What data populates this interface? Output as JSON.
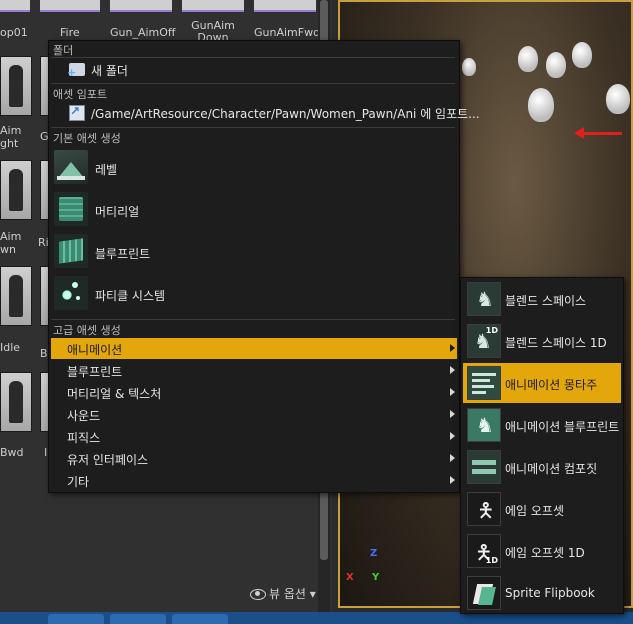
{
  "browser": {
    "top_labels": [
      "op01",
      "Fire",
      "Gun_AimOff",
      "GunAim Down",
      "GunAimFwd"
    ],
    "left_labels": [
      "Aim",
      "ght",
      "G",
      "Aim",
      "wn",
      "Ri",
      "Idle",
      "B",
      "Bwd",
      "I"
    ],
    "view_options": "뷰 옵션"
  },
  "menu": {
    "folder_header": "폴더",
    "new_folder": "새 폴더",
    "import_header": "애셋 임포트",
    "import_path": "/Game/ArtResource/Character/Pawn/Women_Pawn/Ani 에 임포트...",
    "basic_header": "기본 애셋 생성",
    "basic_items": [
      "레벨",
      "머티리얼",
      "블루프린트",
      "파티클 시스템"
    ],
    "advanced_header": "고급 애셋 생성",
    "advanced_items": [
      "애니메이션",
      "블루프린트",
      "머티리얼 & 텍스처",
      "사운드",
      "피직스",
      "유저 인터페이스",
      "기타"
    ]
  },
  "submenu": {
    "items": [
      "블렌드 스페이스",
      "블렌드 스페이스 1D",
      "애니메이션 몽타주",
      "애니메이션 블루프린트",
      "애니메이션 컴포짓",
      "에임 오프셋",
      "에임 오프셋 1D",
      "Sprite Flipbook"
    ],
    "badge_1d": "1D"
  },
  "viewport": {
    "axis_x": "X",
    "axis_y": "Y",
    "axis_z": "Z"
  },
  "colors": {
    "highlight": "#e3a60b",
    "menu_bg": "#1d1d1d"
  }
}
